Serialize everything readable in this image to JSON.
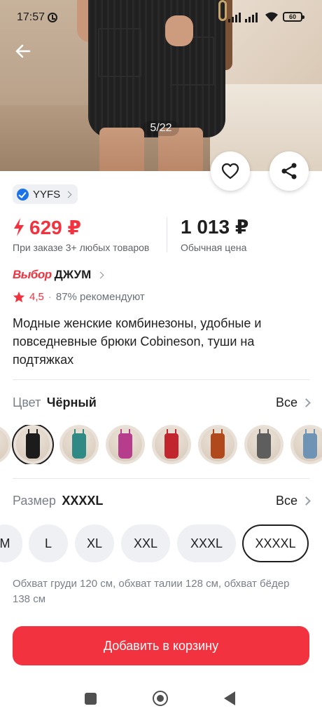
{
  "status_bar": {
    "time": "17:57",
    "battery": "60"
  },
  "gallery": {
    "counter": "5/22"
  },
  "seller": {
    "name": "YYFS"
  },
  "price": {
    "special": "629 ₽",
    "special_note": "При заказе 3+ любых товаров",
    "regular": "1 013 ₽",
    "regular_note": "Обычная цена",
    "accent_color": "#f2333f"
  },
  "choice": {
    "badge": "Выбор",
    "brand": "ДЖУМ"
  },
  "rating": {
    "value": "4,5",
    "separator": "·",
    "recommend": "87% рекомендуют"
  },
  "product": {
    "title": "Модные женские комбинезоны, удобные и повседневные брюки Cobineson, туши на подтяжках"
  },
  "color_section": {
    "label": "Цвет",
    "selected": "Чёрный",
    "all_label": "Все",
    "swatches": [
      {
        "name": "partial",
        "color": "#3a3a3a"
      },
      {
        "name": "black",
        "color": "#1c1c1c"
      },
      {
        "name": "teal",
        "color": "#2f8a86"
      },
      {
        "name": "magenta",
        "color": "#b63c8c"
      },
      {
        "name": "red",
        "color": "#c1252d"
      },
      {
        "name": "rust",
        "color": "#b04a1c"
      },
      {
        "name": "grey",
        "color": "#5e5e5e"
      },
      {
        "name": "blue",
        "color": "#6e93b5"
      }
    ]
  },
  "size_section": {
    "label": "Размер",
    "selected": "XXXXL",
    "all_label": "Все",
    "sizes": [
      "M",
      "L",
      "XL",
      "XXL",
      "XXXL",
      "XXXXL"
    ]
  },
  "size_note": "Обхват груди 120 см, обхват талии 128 см, обхват бёдер 138 см",
  "cart_button": {
    "label": "Добавить в корзину"
  },
  "icons": {
    "back": "arrow-left-icon",
    "favorite": "heart-icon",
    "share": "share-icon",
    "verified": "verified-check-icon",
    "lightning": "lightning-icon",
    "star": "star-icon"
  }
}
